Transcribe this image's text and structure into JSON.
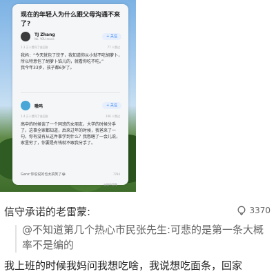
{
  "post": {
    "question": "现在的年轻人为什么跟父母沟通不来了?",
    "answer1": {
      "user": "TJ Zhang",
      "sub": "No. YOU move",
      "follow": "+ 关注",
      "meta": "1.3 万人赞同了该回答",
      "stats": "77 人赞过",
      "text": "我妈：“今天就包了饺子，我知道你从小就不吃胡萝卜，所以特意包了胡萝卜馅儿的，就看你吃不吃。”\n我今年33岁，孩子都6岁了。"
    },
    "answer2": {
      "user": "嗷呜",
      "follow": "+ 关注",
      "meta": "1.4 万人赞同了该回答",
      "stats": "106 人赞过",
      "text": "高中的时候谈了一个同班的女朋友，大学的时候分手了，这事全家都知道，后来过年的时候，我爸来了一句，你有没有从这件事学到什么？我憋瞎了一会儿说，家里穷了，你要是有钱就不跟我分手了。"
    },
    "footer": "Ganz  你说说的也太搞笑了😂",
    "footer_stats": "7784",
    "watermark": "@瑞中官微"
  },
  "comment": {
    "author": "信守承诺的老雷蒙:",
    "likes": "3370",
    "quote": "@不知道第几个热心市民张先生:可悲的是第一条大概率不是编的",
    "reply": "我上班的时候我妈问我想吃啥，我说想吃面条，回家"
  }
}
